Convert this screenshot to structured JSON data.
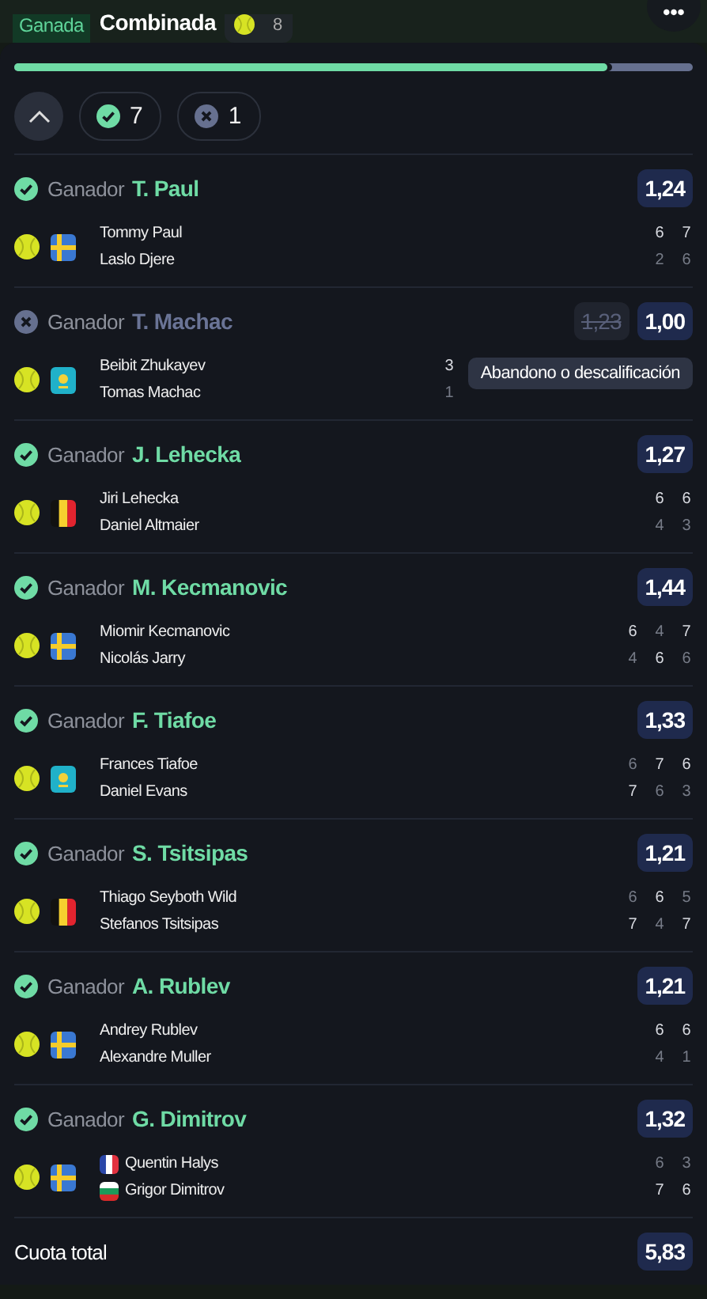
{
  "header": {
    "status_badge": "Ganada",
    "title": "Combinada",
    "sport_count": "8",
    "more_button": "•••"
  },
  "progress": {
    "level": 0.875
  },
  "summary": {
    "expanded": true,
    "won_count": "7",
    "lost_count": "1"
  },
  "selections": [
    {
      "won": true,
      "market": "Ganador",
      "pick": "T. Paul",
      "odds": "1,24",
      "tournament_flag": {
        "kind": "sweden"
      },
      "players": [
        {
          "name": "Tommy Paul",
          "scores": [
            {
              "value": "6",
              "won": true
            },
            {
              "value": "7",
              "won": true
            }
          ]
        },
        {
          "name": "Laslo Djere",
          "scores": [
            {
              "value": "2",
              "won": false
            },
            {
              "value": "6",
              "won": false
            }
          ]
        }
      ]
    },
    {
      "won": false,
      "market": "Ganador",
      "pick": "T. Machac",
      "previous_odds": "1,23",
      "odds": "1,00",
      "note": "Abandono o descalificación",
      "tournament_flag": {
        "kind": "kazakhstan"
      },
      "players": [
        {
          "name": "Beibit Zhukayev",
          "scores": [
            {
              "value": "3",
              "won": true
            }
          ]
        },
        {
          "name": "Tomas Machac",
          "scores": [
            {
              "value": "1",
              "won": false
            }
          ]
        }
      ]
    },
    {
      "won": true,
      "market": "Ganador",
      "pick": "J. Lehecka",
      "odds": "1,27",
      "tournament_flag": {
        "kind": "belgium"
      },
      "players": [
        {
          "name": "Jiri Lehecka",
          "scores": [
            {
              "value": "6",
              "won": true
            },
            {
              "value": "6",
              "won": true
            }
          ]
        },
        {
          "name": "Daniel Altmaier",
          "scores": [
            {
              "value": "4",
              "won": false
            },
            {
              "value": "3",
              "won": false
            }
          ]
        }
      ]
    },
    {
      "won": true,
      "market": "Ganador",
      "pick": "M. Kecmanovic",
      "odds": "1,44",
      "tournament_flag": {
        "kind": "sweden"
      },
      "players": [
        {
          "name": "Miomir Kecmanovic",
          "scores": [
            {
              "value": "6",
              "won": true
            },
            {
              "value": "4",
              "won": false
            },
            {
              "value": "7",
              "won": true
            }
          ]
        },
        {
          "name": "Nicolás Jarry",
          "scores": [
            {
              "value": "4",
              "won": false
            },
            {
              "value": "6",
              "won": true
            },
            {
              "value": "6",
              "won": false
            }
          ]
        }
      ]
    },
    {
      "won": true,
      "market": "Ganador",
      "pick": "F. Tiafoe",
      "odds": "1,33",
      "tournament_flag": {
        "kind": "kazakhstan"
      },
      "players": [
        {
          "name": "Frances Tiafoe",
          "scores": [
            {
              "value": "6",
              "won": false
            },
            {
              "value": "7",
              "won": true
            },
            {
              "value": "6",
              "won": true
            }
          ]
        },
        {
          "name": "Daniel Evans",
          "scores": [
            {
              "value": "7",
              "won": true
            },
            {
              "value": "6",
              "won": false
            },
            {
              "value": "3",
              "won": false
            }
          ]
        }
      ]
    },
    {
      "won": true,
      "market": "Ganador",
      "pick": "S. Tsitsipas",
      "odds": "1,21",
      "tournament_flag": {
        "kind": "belgium"
      },
      "players": [
        {
          "name": "Thiago Seyboth Wild",
          "scores": [
            {
              "value": "6",
              "won": false
            },
            {
              "value": "6",
              "won": true
            },
            {
              "value": "5",
              "won": false
            }
          ]
        },
        {
          "name": "Stefanos Tsitsipas",
          "scores": [
            {
              "value": "7",
              "won": true
            },
            {
              "value": "4",
              "won": false
            },
            {
              "value": "7",
              "won": true
            }
          ]
        }
      ]
    },
    {
      "won": true,
      "market": "Ganador",
      "pick": "A. Rublev",
      "odds": "1,21",
      "tournament_flag": {
        "kind": "sweden"
      },
      "players": [
        {
          "name": "Andrey Rublev",
          "scores": [
            {
              "value": "6",
              "won": true
            },
            {
              "value": "6",
              "won": true
            }
          ]
        },
        {
          "name": "Alexandre Muller",
          "scores": [
            {
              "value": "4",
              "won": false
            },
            {
              "value": "1",
              "won": false
            }
          ]
        }
      ]
    },
    {
      "won": true,
      "market": "Ganador",
      "pick": "G. Dimitrov",
      "odds": "1,32",
      "tournament_flag": {
        "kind": "sweden"
      },
      "players": [
        {
          "name": "Quentin Halys",
          "flag": {
            "kind": "france"
          },
          "scores": [
            {
              "value": "6",
              "won": false
            },
            {
              "value": "3",
              "won": false
            }
          ]
        },
        {
          "name": "Grigor Dimitrov",
          "flag": {
            "kind": "bulgaria"
          },
          "scores": [
            {
              "value": "7",
              "won": true
            },
            {
              "value": "6",
              "won": true
            }
          ]
        }
      ]
    }
  ],
  "total": {
    "label": "Cuota total",
    "odds": "5,83"
  }
}
